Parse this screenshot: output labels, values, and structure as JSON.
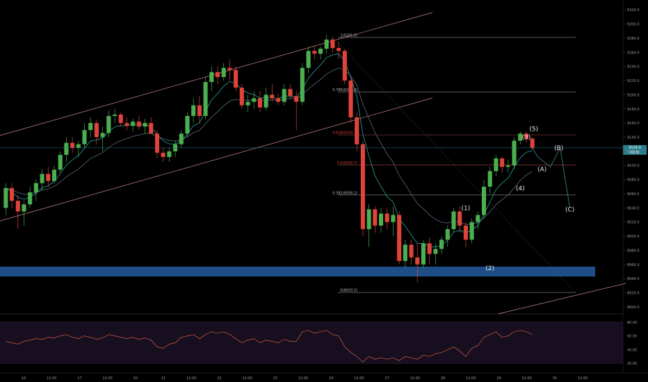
{
  "colors": {
    "background": "#000000",
    "candle_up": "#4caf50",
    "candle_down": "#e0433a",
    "channel": "#c98a8a",
    "fib_line": "#8c8c8c",
    "fib_label_red": "#e0433a",
    "support_zone": "#1d4f86",
    "ma_fast": "#27a8a1",
    "ma_slow": "#5b6c82",
    "projection": "#3a8f9c",
    "rsi_line": "#d5613f",
    "rsi_band": "#2a1a3a",
    "price_tag": "#2a7f8f"
  },
  "icons": {
    "price_marker": "price-tag-icon"
  },
  "current_price": {
    "value": 9124.9,
    "label": "9124.9",
    "timer": "03:31"
  },
  "chart_data": [
    {
      "type": "candlestick",
      "title": "",
      "ylim": [
        8895,
        9330
      ],
      "y_ticks": [
        "9320.0",
        "9300.0",
        "9280.0",
        "9260.0",
        "9240.0",
        "9220.0",
        "9200.0",
        "9180.0",
        "9160.0",
        "9140.0",
        "9120.0",
        "9100.0",
        "9080.0",
        "9060.0",
        "9040.0",
        "9020.0",
        "9000.0",
        "8980.0",
        "8960.0",
        "8940.0",
        "8920.0",
        "8900.0"
      ],
      "x_ticks": [
        "16",
        "12:00",
        "17",
        "12:00",
        "20",
        "21",
        "12:00",
        "22",
        "12:00",
        "23",
        "12:00",
        "24",
        "12:00",
        "27",
        "12:00",
        "28",
        "12:00",
        "29",
        "12:00",
        "30",
        "12:00"
      ],
      "candles": [
        {
          "o": 9040,
          "h": 9075,
          "l": 9030,
          "c": 9068
        },
        {
          "o": 9068,
          "h": 9075,
          "l": 9040,
          "c": 9050
        },
        {
          "o": 9050,
          "h": 9058,
          "l": 9010,
          "c": 9035
        },
        {
          "o": 9035,
          "h": 9050,
          "l": 9015,
          "c": 9045
        },
        {
          "o": 9045,
          "h": 9070,
          "l": 9040,
          "c": 9062
        },
        {
          "o": 9062,
          "h": 9080,
          "l": 9050,
          "c": 9075
        },
        {
          "o": 9075,
          "h": 9095,
          "l": 9065,
          "c": 9088
        },
        {
          "o": 9088,
          "h": 9098,
          "l": 9070,
          "c": 9078
        },
        {
          "o": 9078,
          "h": 9100,
          "l": 9075,
          "c": 9094
        },
        {
          "o": 9094,
          "h": 9120,
          "l": 9090,
          "c": 9115
        },
        {
          "o": 9115,
          "h": 9140,
          "l": 9105,
          "c": 9132
        },
        {
          "o": 9132,
          "h": 9140,
          "l": 9118,
          "c": 9125
        },
        {
          "o": 9125,
          "h": 9135,
          "l": 9112,
          "c": 9130
        },
        {
          "o": 9130,
          "h": 9160,
          "l": 9125,
          "c": 9150
        },
        {
          "o": 9150,
          "h": 9168,
          "l": 9140,
          "c": 9160
        },
        {
          "o": 9160,
          "h": 9165,
          "l": 9130,
          "c": 9140
        },
        {
          "o": 9140,
          "h": 9155,
          "l": 9120,
          "c": 9146
        },
        {
          "o": 9146,
          "h": 9178,
          "l": 9140,
          "c": 9170
        },
        {
          "o": 9170,
          "h": 9180,
          "l": 9160,
          "c": 9172
        },
        {
          "o": 9172,
          "h": 9175,
          "l": 9155,
          "c": 9160
        },
        {
          "o": 9160,
          "h": 9168,
          "l": 9150,
          "c": 9156
        },
        {
          "o": 9156,
          "h": 9166,
          "l": 9148,
          "c": 9162
        },
        {
          "o": 9162,
          "h": 9170,
          "l": 9150,
          "c": 9155
        },
        {
          "o": 9155,
          "h": 9166,
          "l": 9145,
          "c": 9160
        },
        {
          "o": 9160,
          "h": 9168,
          "l": 9150,
          "c": 9145
        },
        {
          "o": 9145,
          "h": 9150,
          "l": 9110,
          "c": 9118
        },
        {
          "o": 9118,
          "h": 9125,
          "l": 9105,
          "c": 9112
        },
        {
          "o": 9112,
          "h": 9125,
          "l": 9105,
          "c": 9120
        },
        {
          "o": 9120,
          "h": 9135,
          "l": 9112,
          "c": 9130
        },
        {
          "o": 9130,
          "h": 9150,
          "l": 9125,
          "c": 9145
        },
        {
          "o": 9145,
          "h": 9175,
          "l": 9140,
          "c": 9170
        },
        {
          "o": 9170,
          "h": 9195,
          "l": 9160,
          "c": 9185
        },
        {
          "o": 9185,
          "h": 9198,
          "l": 9160,
          "c": 9170
        },
        {
          "o": 9170,
          "h": 9225,
          "l": 9165,
          "c": 9218
        },
        {
          "o": 9218,
          "h": 9240,
          "l": 9205,
          "c": 9232
        },
        {
          "o": 9232,
          "h": 9240,
          "l": 9215,
          "c": 9225
        },
        {
          "o": 9225,
          "h": 9245,
          "l": 9220,
          "c": 9238
        },
        {
          "o": 9238,
          "h": 9250,
          "l": 9220,
          "c": 9235
        },
        {
          "o": 9235,
          "h": 9240,
          "l": 9205,
          "c": 9210
        },
        {
          "o": 9210,
          "h": 9215,
          "l": 9180,
          "c": 9185
        },
        {
          "o": 9185,
          "h": 9200,
          "l": 9175,
          "c": 9190
        },
        {
          "o": 9190,
          "h": 9205,
          "l": 9180,
          "c": 9195
        },
        {
          "o": 9195,
          "h": 9205,
          "l": 9175,
          "c": 9182
        },
        {
          "o": 9182,
          "h": 9210,
          "l": 9178,
          "c": 9200
        },
        {
          "o": 9200,
          "h": 9215,
          "l": 9190,
          "c": 9195
        },
        {
          "o": 9195,
          "h": 9202,
          "l": 9185,
          "c": 9190
        },
        {
          "o": 9190,
          "h": 9215,
          "l": 9185,
          "c": 9208
        },
        {
          "o": 9208,
          "h": 9215,
          "l": 9195,
          "c": 9198
        },
        {
          "o": 9198,
          "h": 9205,
          "l": 9150,
          "c": 9190
        },
        {
          "o": 9190,
          "h": 9245,
          "l": 9185,
          "c": 9238
        },
        {
          "o": 9238,
          "h": 9268,
          "l": 9230,
          "c": 9262
        },
        {
          "o": 9262,
          "h": 9270,
          "l": 9250,
          "c": 9258
        },
        {
          "o": 9258,
          "h": 9268,
          "l": 9250,
          "c": 9265
        },
        {
          "o": 9265,
          "h": 9285,
          "l": 9258,
          "c": 9278
        },
        {
          "o": 9278,
          "h": 9282,
          "l": 9260,
          "c": 9266
        },
        {
          "o": 9266,
          "h": 9275,
          "l": 9250,
          "c": 9262
        },
        {
          "o": 9262,
          "h": 9265,
          "l": 9215,
          "c": 9220
        },
        {
          "o": 9220,
          "h": 9225,
          "l": 9160,
          "c": 9168
        },
        {
          "o": 9168,
          "h": 9175,
          "l": 9120,
          "c": 9130
        },
        {
          "o": 9130,
          "h": 9135,
          "l": 9000,
          "c": 9010
        },
        {
          "o": 9010,
          "h": 9045,
          "l": 8985,
          "c": 9038
        },
        {
          "o": 9038,
          "h": 9042,
          "l": 9005,
          "c": 9015
        },
        {
          "o": 9015,
          "h": 9040,
          "l": 9005,
          "c": 9032
        },
        {
          "o": 9032,
          "h": 9040,
          "l": 9010,
          "c": 9020
        },
        {
          "o": 9020,
          "h": 9042,
          "l": 9000,
          "c": 9030
        },
        {
          "o": 9030,
          "h": 9035,
          "l": 8960,
          "c": 8965
        },
        {
          "o": 8965,
          "h": 8995,
          "l": 8955,
          "c": 8988
        },
        {
          "o": 8988,
          "h": 8995,
          "l": 8960,
          "c": 8970
        },
        {
          "o": 8970,
          "h": 8990,
          "l": 8935,
          "c": 8960
        },
        {
          "o": 8960,
          "h": 8995,
          "l": 8955,
          "c": 8990
        },
        {
          "o": 8990,
          "h": 8998,
          "l": 8960,
          "c": 8975
        },
        {
          "o": 8975,
          "h": 8990,
          "l": 8960,
          "c": 8982
        },
        {
          "o": 8982,
          "h": 9000,
          "l": 8975,
          "c": 8995
        },
        {
          "o": 8995,
          "h": 9015,
          "l": 8985,
          "c": 9010
        },
        {
          "o": 9010,
          "h": 9040,
          "l": 9005,
          "c": 9035
        },
        {
          "o": 9035,
          "h": 9042,
          "l": 9005,
          "c": 9015
        },
        {
          "o": 9015,
          "h": 9020,
          "l": 8985,
          "c": 8995
        },
        {
          "o": 8995,
          "h": 9025,
          "l": 8990,
          "c": 9020
        },
        {
          "o": 9020,
          "h": 9035,
          "l": 9010,
          "c": 9030
        },
        {
          "o": 9030,
          "h": 9080,
          "l": 9025,
          "c": 9070
        },
        {
          "o": 9070,
          "h": 9098,
          "l": 9060,
          "c": 9092
        },
        {
          "o": 9092,
          "h": 9115,
          "l": 9085,
          "c": 9110
        },
        {
          "o": 9110,
          "h": 9112,
          "l": 9090,
          "c": 9098
        },
        {
          "o": 9098,
          "h": 9108,
          "l": 9090,
          "c": 9100
        },
        {
          "o": 9100,
          "h": 9140,
          "l": 9095,
          "c": 9135
        },
        {
          "o": 9135,
          "h": 9148,
          "l": 9130,
          "c": 9145
        },
        {
          "o": 9145,
          "h": 9148,
          "l": 9132,
          "c": 9138
        },
        {
          "o": 9138,
          "h": 9140,
          "l": 9122,
          "c": 9125
        }
      ],
      "fibonacci": [
        {
          "label": "1(9281.0)",
          "value": 9281.0
        },
        {
          "label": "0.786(9203.8)",
          "value": 9203.8
        },
        {
          "label": "0.618(9143.3)",
          "value": 9143.3,
          "highlight": true
        },
        {
          "label": "0.5(9100.7)",
          "value": 9100.7,
          "highlight": true
        },
        {
          "label": "0.382(9058.2)",
          "value": 9058.2
        },
        {
          "label": "0(8920.5)",
          "value": 8920.5
        }
      ],
      "support_zone": {
        "low": 8943,
        "high": 8957
      },
      "wave_labels": [
        {
          "text": "(1)",
          "value": 9040
        },
        {
          "text": "(2)",
          "value": 8955
        },
        {
          "text": "(3)",
          "value": 9140
        },
        {
          "text": "(4)",
          "value": 9068
        },
        {
          "text": "(5)",
          "value": 9152
        },
        {
          "text": "(A)",
          "value": 9095
        },
        {
          "text": "(B)",
          "value": 9125
        },
        {
          "text": "(C)",
          "value": 9038
        }
      ]
    },
    {
      "type": "line",
      "title": "",
      "ylim": [
        10,
        88
      ],
      "y_ticks": [
        "80.00",
        "60.00",
        "40.00",
        "20.00"
      ],
      "bands": [
        80,
        20
      ],
      "values": [
        52,
        50,
        48,
        52,
        54,
        56,
        55,
        58,
        57,
        60,
        62,
        58,
        56,
        60,
        58,
        55,
        57,
        62,
        60,
        58,
        56,
        58,
        55,
        57,
        54,
        44,
        42,
        48,
        50,
        58,
        60,
        62,
        56,
        62,
        66,
        64,
        66,
        62,
        56,
        50,
        54,
        56,
        50,
        54,
        52,
        50,
        55,
        52,
        52,
        66,
        68,
        64,
        66,
        68,
        62,
        60,
        44,
        36,
        30,
        22,
        30,
        26,
        28,
        26,
        28,
        24,
        30,
        28,
        26,
        32,
        30,
        34,
        36,
        40,
        44,
        38,
        30,
        42,
        46,
        58,
        62,
        66,
        58,
        60,
        66,
        68,
        66,
        62
      ]
    }
  ]
}
